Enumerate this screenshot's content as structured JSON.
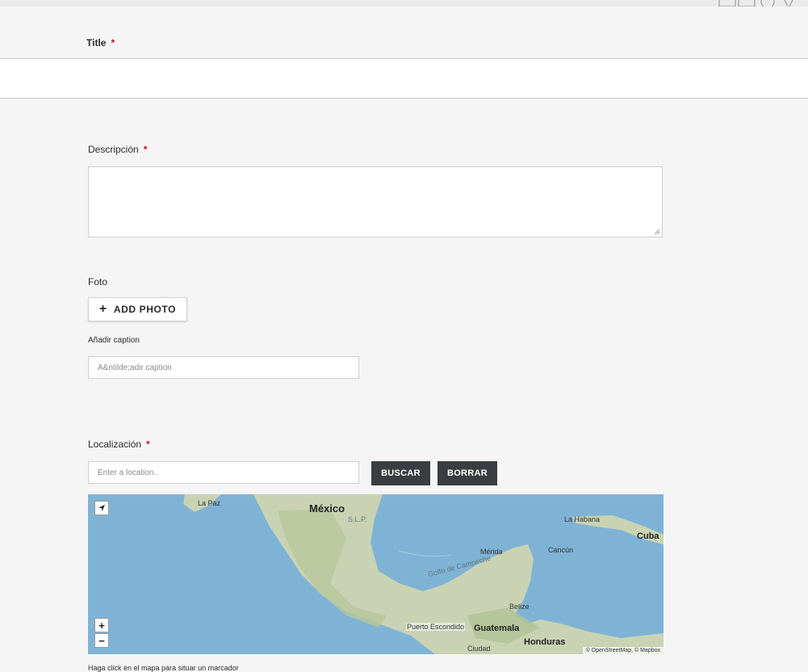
{
  "form": {
    "title_label": "Title",
    "required_mark": "*",
    "description_label": "Descripción",
    "photo_label": "Foto",
    "add_photo_button": "ADD PHOTO",
    "add_photo_icon": "plus-icon",
    "caption_label": "Añadir caption",
    "caption_placeholder": "A&ntilde;adir caption",
    "location_label": "Localización",
    "location_placeholder": "Enter a location..",
    "search_button": "BUSCAR",
    "clear_button": "BORRAR",
    "map_hint": "Haga click en el mapa para situar un marcador"
  },
  "map": {
    "zoom_in": "+",
    "zoom_out": "−",
    "locate_icon": "locate-arrow-icon",
    "attribution": "© OpenStreetMap, © Mapbox",
    "labels": {
      "mexico": "México",
      "la_paz": "La Paz",
      "slp": "S.L.P.",
      "la_habana": "La Habana",
      "cuba": "Cuba",
      "cancun": "Cancún",
      "merida": "Mérida",
      "belize": "Belize",
      "puerto_escondido": "Puerto Escondido",
      "guatemala": "Guatemala",
      "honduras": "Honduras",
      "ciudad": "Ciudad",
      "golfo": "Golfo de Campeche"
    }
  },
  "colors": {
    "required": "#c8102e",
    "button_dark": "#3a3d42",
    "water": "#7fb3d5",
    "land": "#c9d3b3"
  }
}
